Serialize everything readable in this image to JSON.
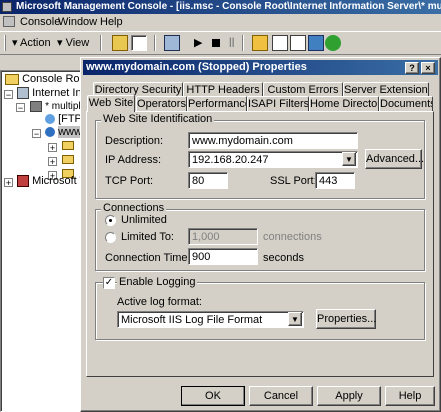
{
  "mmc": {
    "title": "Microsoft Management Console - [iis.msc - Console Root\\Internet Information Server\\* multiple",
    "menu": [
      "Console",
      "Window",
      "Help"
    ],
    "toolbar": {
      "action": "Action",
      "view": "View"
    }
  },
  "tree": {
    "root": "Console Root",
    "iis": "Internet Info",
    "multiple": "* multiple",
    "ftp": "[FTP",
    "www": "www",
    "mts": "Microsoft Tra"
  },
  "dialog": {
    "title": "www.mydomain.com (Stopped) Properties",
    "help_btn": "?",
    "close_btn": "×",
    "tabs_back": [
      "Directory Security",
      "HTTP Headers",
      "Custom Errors",
      "Server Extensions"
    ],
    "tabs_front": [
      "Web Site",
      "Operators",
      "Performance",
      "ISAPI Filters",
      "Home Directory",
      "Documents"
    ],
    "identification": {
      "group": "Web Site Identification",
      "description_label": "Description:",
      "description_value": "www.mydomain.com",
      "ip_label": "IP Address:",
      "ip_value": "192.168.20.247",
      "advanced": "Advanced...",
      "tcp_label": "TCP Port:",
      "tcp_value": "80",
      "ssl_label": "SSL Port:",
      "ssl_value": "443"
    },
    "connections": {
      "group": "Connections",
      "unlimited": "Unlimited",
      "limited": "Limited To:",
      "limited_value": "1,000",
      "connections_unit": "connections",
      "timeout_label": "Connection Timeout:",
      "timeout_value": "900",
      "seconds": "seconds"
    },
    "logging": {
      "enable": "Enable Logging",
      "format_label": "Active log format:",
      "format_value": "Microsoft IIS Log File Format",
      "properties": "Properties..."
    },
    "buttons": {
      "ok": "OK",
      "cancel": "Cancel",
      "apply": "Apply",
      "help": "Help"
    }
  }
}
